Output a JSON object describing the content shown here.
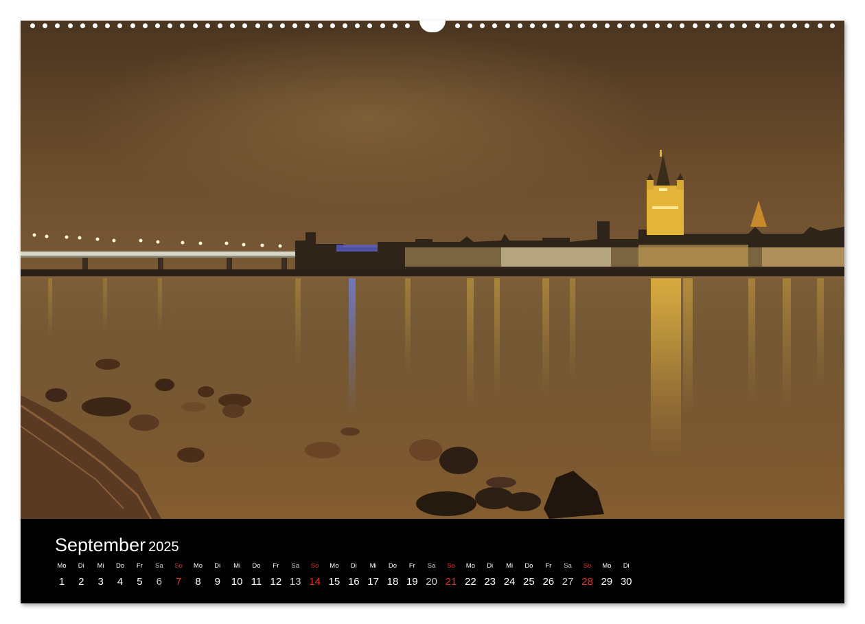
{
  "calendar": {
    "month": "September",
    "year": "2025",
    "sunday_color": "#e2322f",
    "days": [
      {
        "name": "Mo",
        "date": "1"
      },
      {
        "name": "Di",
        "date": "2"
      },
      {
        "name": "Mi",
        "date": "3"
      },
      {
        "name": "Do",
        "date": "4"
      },
      {
        "name": "Fr",
        "date": "5"
      },
      {
        "name": "Sa",
        "date": "6"
      },
      {
        "name": "So",
        "date": "7"
      },
      {
        "name": "Mo",
        "date": "8"
      },
      {
        "name": "Di",
        "date": "9"
      },
      {
        "name": "Mi",
        "date": "10"
      },
      {
        "name": "Do",
        "date": "11"
      },
      {
        "name": "Fr",
        "date": "12"
      },
      {
        "name": "Sa",
        "date": "13"
      },
      {
        "name": "So",
        "date": "14"
      },
      {
        "name": "Mo",
        "date": "15"
      },
      {
        "name": "Di",
        "date": "16"
      },
      {
        "name": "Mi",
        "date": "17"
      },
      {
        "name": "Do",
        "date": "18"
      },
      {
        "name": "Fr",
        "date": "19"
      },
      {
        "name": "Sa",
        "date": "20"
      },
      {
        "name": "So",
        "date": "21"
      },
      {
        "name": "Mo",
        "date": "22"
      },
      {
        "name": "Di",
        "date": "23"
      },
      {
        "name": "Mi",
        "date": "24"
      },
      {
        "name": "Do",
        "date": "25"
      },
      {
        "name": "Fr",
        "date": "26"
      },
      {
        "name": "Sa",
        "date": "27"
      },
      {
        "name": "So",
        "date": "28"
      },
      {
        "name": "Mo",
        "date": "29"
      },
      {
        "name": "Di",
        "date": "30"
      }
    ]
  }
}
